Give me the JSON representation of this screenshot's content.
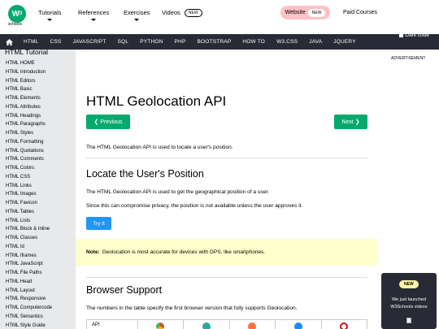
{
  "header": {
    "logo_text": "W",
    "logo_sup": "3",
    "logo_sub": "schools",
    "nav": [
      {
        "label": "Tutorials"
      },
      {
        "label": "References"
      },
      {
        "label": "Exercises"
      }
    ],
    "videos_label": "Videos",
    "new_badge": "NEW",
    "website_label": "Website",
    "paid_courses_label": "Paid Courses"
  },
  "topnav": {
    "items": [
      "HTML",
      "CSS",
      "JAVASCRIPT",
      "SQL",
      "PYTHON",
      "PHP",
      "BOOTSTRAP",
      "HOW TO",
      "W3.CSS",
      "JAVA",
      "JQUERY"
    ],
    "dark_code_label": "Dark code"
  },
  "sidebar": {
    "title": "HTML Tutorial",
    "items": [
      "HTML HOME",
      "HTML Introduction",
      "HTML Editors",
      "HTML Basic",
      "HTML Elements",
      "HTML Attributes",
      "HTML Headings",
      "HTML Paragraphs",
      "HTML Styles",
      "HTML Formatting",
      "HTML Quotations",
      "HTML Comments",
      "HTML Colors",
      "HTML CSS",
      "HTML Links",
      "HTML Images",
      "HTML Favicon",
      "HTML Tables",
      "HTML Lists",
      "HTML Block & Inline",
      "HTML Classes",
      "HTML Id",
      "HTML Iframes",
      "HTML JavaScript",
      "HTML File Paths",
      "HTML Head",
      "HTML Layout",
      "HTML Responsive",
      "HTML Computercode",
      "HTML Semantics",
      "HTML Style Guide"
    ]
  },
  "main": {
    "title": "HTML Geolocation API",
    "prev_label": "❮ Previous",
    "next_label": "Next ❯",
    "intro": "The HTML Geolocation API is used to locate a user's position.",
    "section1_title": "Locate the User's Position",
    "section1_p1": "The HTML Geolocation API is used to get the geographical position of a user.",
    "section1_p2": "Since this can compromise privacy, the position is not available unless the user approves it.",
    "tryit_label": "Try It",
    "note_label": "Note:",
    "note_text": "Geolocation is most accurate for devices with GPS, like smartphones.",
    "section2_title": "Browser Support",
    "section2_p": "The numbers in the table specify the first browser version that fully supports Geolocation.",
    "table_header": "API",
    "browser_icons": [
      {
        "name": "chrome-icon",
        "color": "#dd4b39"
      },
      {
        "name": "edge-icon",
        "color": "#2aa8a0"
      },
      {
        "name": "firefox-icon",
        "color": "#ff7139"
      },
      {
        "name": "safari-icon",
        "color": "#1a8cff"
      },
      {
        "name": "opera-icon",
        "color": "#cc0f16"
      }
    ]
  },
  "right": {
    "ad_label": "ADVERTISEMENT",
    "promo_new": "NEW",
    "promo_line1": "We just launched",
    "promo_line2": "W3Schools videos"
  },
  "colors": {
    "brand_green": "#04aa6d",
    "dark_nav": "#282a35",
    "sidebar_bg": "#e7e9eb",
    "note_bg": "#ffffcc",
    "tryit_blue": "#2196f3",
    "website_pink": "#ffc0c7"
  }
}
